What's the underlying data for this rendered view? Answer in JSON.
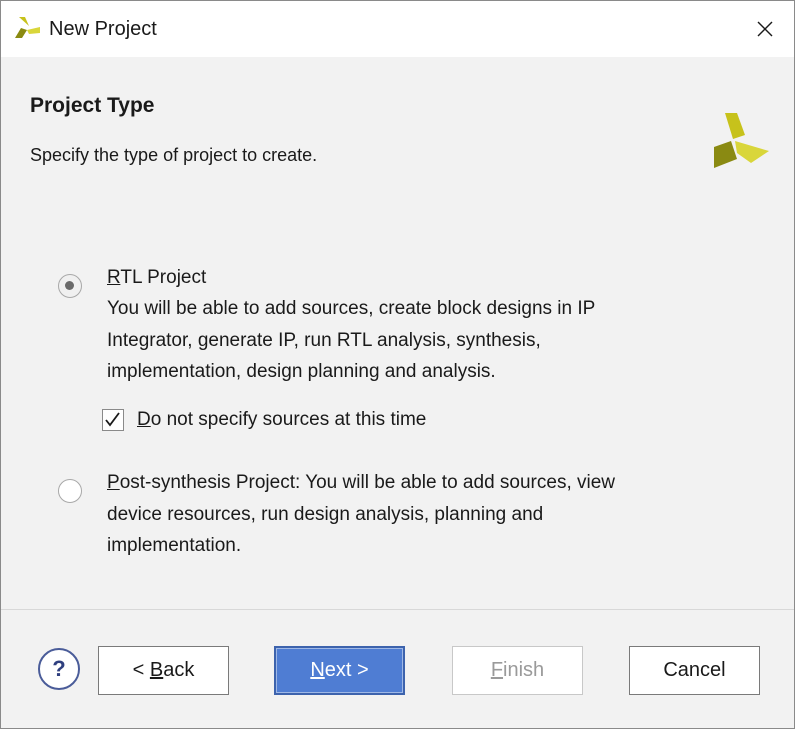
{
  "window": {
    "title": "New Project",
    "close_icon": "close-icon",
    "app_icon": "vivado-logo-icon"
  },
  "header": {
    "title": "Project Type",
    "subtitle": "Specify the type of project to create."
  },
  "options": {
    "rtl": {
      "mnemonic": "R",
      "label_rest": "TL Project",
      "selected": true,
      "description_lines": [
        "You will be able to add sources, create block designs in IP",
        "Integrator, generate IP, run RTL analysis, synthesis,",
        "implementation, design planning and analysis."
      ],
      "no_sources": {
        "mnemonic": "D",
        "label_rest": "o not specify sources at this time",
        "checked": true
      }
    },
    "post_synthesis": {
      "mnemonic": "P",
      "line1_rest": "ost-synthesis Project: You will be able to add sources, view",
      "lines": [
        "device resources, run design analysis, planning and",
        "implementation."
      ],
      "selected": false
    }
  },
  "footer": {
    "help_label": "?",
    "back": {
      "prefix": "< ",
      "mnemonic": "B",
      "rest": "ack"
    },
    "next": {
      "mnemonic": "N",
      "rest": "ext >"
    },
    "finish": {
      "mnemonic": "F",
      "rest": "inish",
      "enabled": false
    },
    "cancel": "Cancel"
  },
  "colors": {
    "accent": "#4f7dd3",
    "logo_yellow": "#c7c21b",
    "logo_olive": "#8a8a12"
  }
}
